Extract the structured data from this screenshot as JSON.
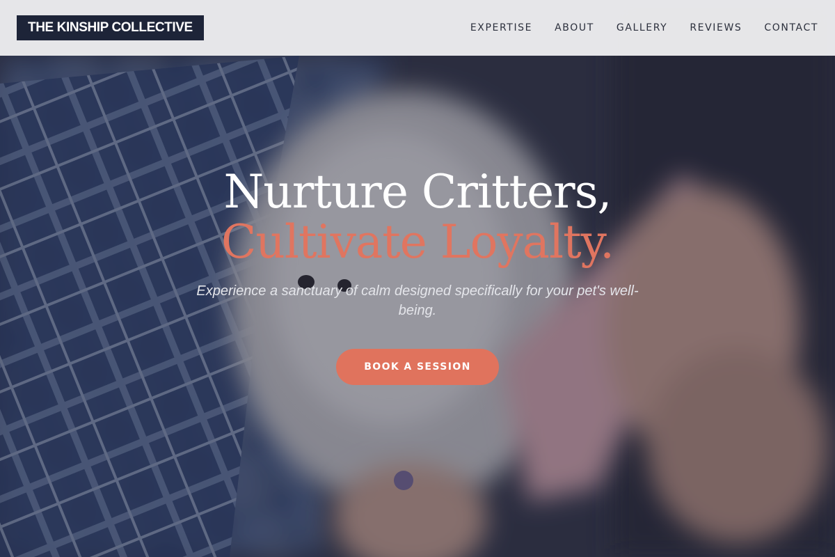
{
  "brand": {
    "name": "THE KINSHIP COLLECTIVE"
  },
  "nav": {
    "items": [
      {
        "label": "EXPERTISE"
      },
      {
        "label": "ABOUT"
      },
      {
        "label": "GALLERY"
      },
      {
        "label": "REVIEWS"
      },
      {
        "label": "CONTACT"
      }
    ]
  },
  "hero": {
    "title_line1": "Nurture Critters,",
    "title_line2": "Cultivate Loyalty.",
    "subtitle": "Experience a sanctuary of calm designed specifically for your pet's well-being.",
    "cta_label": "BOOK A SESSION"
  },
  "colors": {
    "accent": "#e0735d",
    "brand_dark": "#1d2438",
    "header_bg": "#ececee"
  }
}
